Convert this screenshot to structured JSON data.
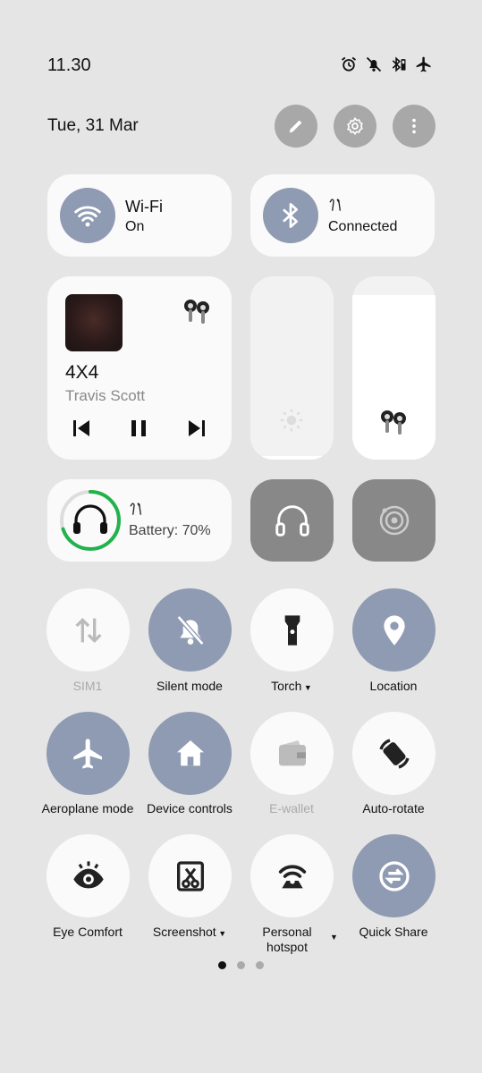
{
  "status_bar": {
    "time": "11.30",
    "icons": [
      "alarm-icon",
      "bell-off-icon",
      "bluetooth-battery-icon",
      "airplane-icon"
    ]
  },
  "header": {
    "date": "Tue, 31 Mar",
    "buttons": [
      "edit-icon",
      "settings-icon",
      "more-icon"
    ]
  },
  "wifi_tile": {
    "title": "Wi-Fi",
    "status": "On"
  },
  "bluetooth_tile": {
    "status": "Connected"
  },
  "media": {
    "track": "4X4",
    "artist": "Travis Scott"
  },
  "brightness_level": 0.02,
  "volume_level": 0.9,
  "earbuds": {
    "battery": "Battery: 70%",
    "battery_level": 0.7
  },
  "quick_settings": [
    {
      "label": "SIM1",
      "icon": "data-transfer-icon",
      "state": "disabled"
    },
    {
      "label": "Silent mode",
      "icon": "bell-off-icon",
      "state": "on"
    },
    {
      "label": "Torch",
      "icon": "flashlight-icon",
      "state": "off"
    },
    {
      "label": "Location",
      "icon": "location-icon",
      "state": "on"
    },
    {
      "label": "Aeroplane mode",
      "icon": "airplane-icon",
      "state": "on"
    },
    {
      "label": "Device controls",
      "icon": "home-icon",
      "state": "on"
    },
    {
      "label": "E-wallet",
      "icon": "wallet-icon",
      "state": "disabled"
    },
    {
      "label": "Auto-rotate",
      "icon": "rotate-icon",
      "state": "off"
    },
    {
      "label": "Eye Comfort",
      "icon": "eye-icon",
      "state": "off"
    },
    {
      "label": "Screenshot",
      "icon": "screenshot-icon",
      "state": "off"
    },
    {
      "label": "Personal hotspot",
      "icon": "hotspot-icon",
      "state": "off"
    },
    {
      "label": "Quick Share",
      "icon": "quick-share-icon",
      "state": "on"
    }
  ],
  "colors": {
    "accent": "#8f9bb2",
    "battery_ring": "#22b24c",
    "background": "#e5e5e5"
  },
  "page_indicator": {
    "pages": 3,
    "current": 1
  }
}
